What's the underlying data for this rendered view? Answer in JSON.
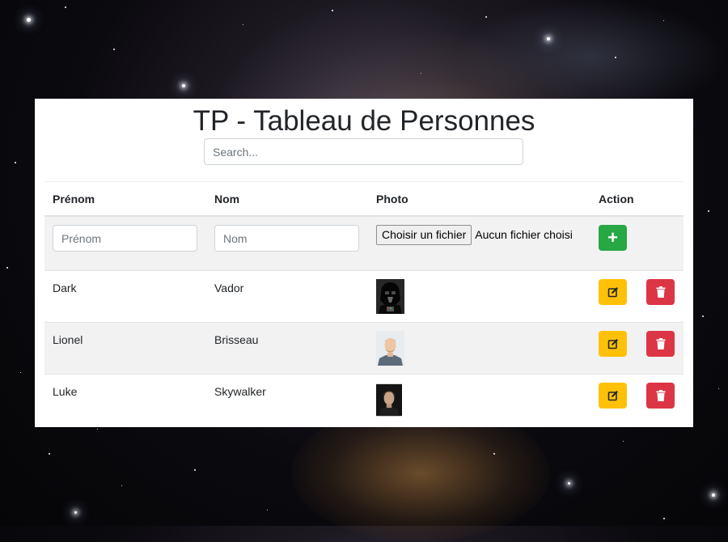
{
  "page": {
    "title": "TP - Tableau de Personnes",
    "search_placeholder": "Search..."
  },
  "table": {
    "headers": {
      "first_name": "Prénom",
      "last_name": "Nom",
      "photo": "Photo",
      "action": "Action"
    },
    "add_row": {
      "first_name_placeholder": "Prénom",
      "last_name_placeholder": "Nom",
      "file_button_label": "Choisir un fichier",
      "file_status": "Aucun fichier choisi",
      "add_icon": "plus-icon"
    },
    "rows": [
      {
        "first_name": "Dark",
        "last_name": "Vador",
        "photo_icon": "darth-vader-photo"
      },
      {
        "first_name": "Lionel",
        "last_name": "Brisseau",
        "photo_icon": "man-portrait-photo"
      },
      {
        "first_name": "Luke",
        "last_name": "Skywalker",
        "photo_icon": "luke-skywalker-photo"
      }
    ],
    "edit_icon": "edit-icon",
    "delete_icon": "trash-icon"
  },
  "colors": {
    "add": "#28a745",
    "edit": "#ffc107",
    "delete": "#dc3545",
    "stripe": "#f2f2f2"
  }
}
